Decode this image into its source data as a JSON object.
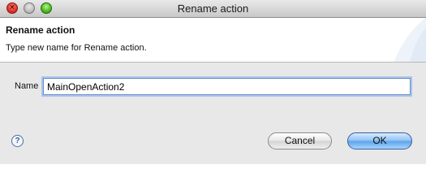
{
  "window": {
    "title": "Rename action"
  },
  "header": {
    "title": "Rename action",
    "description": "Type new name for Rename action."
  },
  "form": {
    "name_label": "Name",
    "name_value": "MainOpenAction2"
  },
  "buttons": {
    "cancel_label": "Cancel",
    "ok_label": "OK"
  },
  "help": {
    "glyph": "?",
    "icon": "help-icon"
  },
  "colors": {
    "ok_button": "#5aa2ea",
    "focus_ring": "#a9c4ee",
    "header_background": "#ffffff",
    "window_background": "#e8e8e8"
  }
}
